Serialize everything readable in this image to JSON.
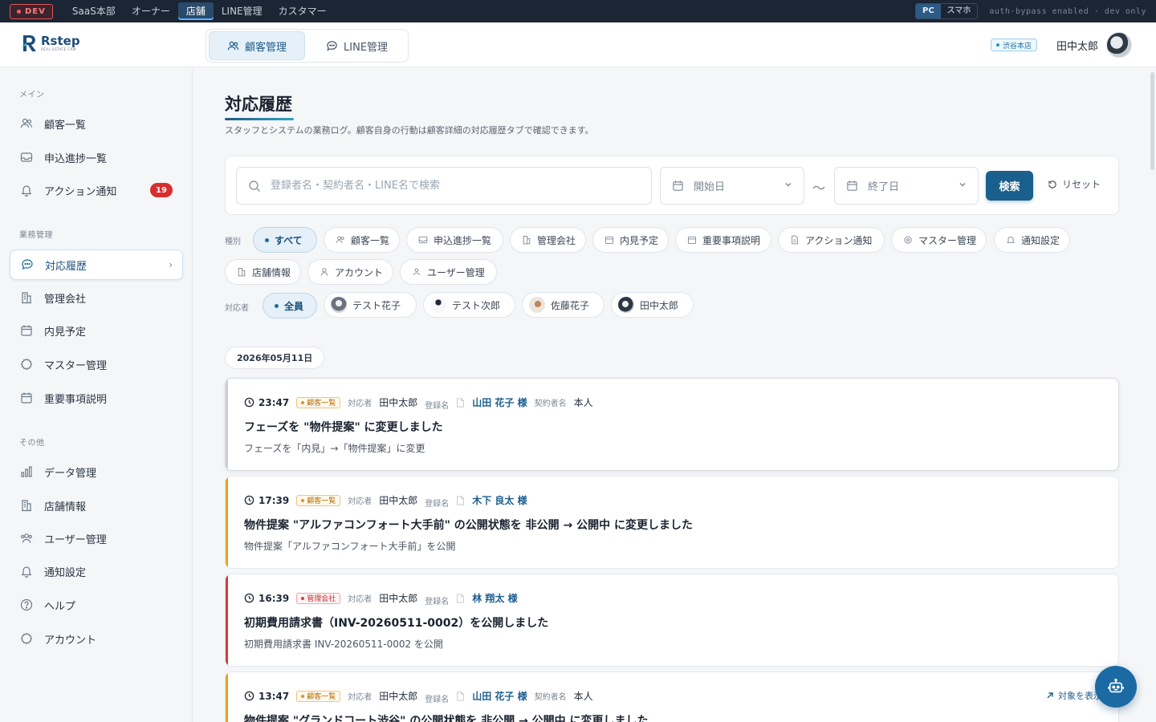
{
  "devbar": {
    "badge": "DEV",
    "tabs": [
      "SaaS本部",
      "オーナー",
      "店舗",
      "LINE管理",
      "カスタマー"
    ],
    "active_tab": "店舗",
    "device": [
      "PC",
      "スマホ"
    ],
    "note": "auth-bypass enabled · dev only"
  },
  "header": {
    "logo": "Rstep",
    "logo_sub": "REAL ESTATE CRM",
    "tabs": [
      "顧客管理",
      "LINE管理"
    ],
    "store": "渋谷本店",
    "user": "田中太郎"
  },
  "sidebar": {
    "sections": [
      "メイン",
      "業務管理",
      "その他"
    ],
    "main": [
      {
        "label": "顧客一覧",
        "icon": "users-icon"
      },
      {
        "label": "申込進捗一覧",
        "icon": "inbox-icon"
      },
      {
        "label": "アクション通知",
        "icon": "bell-icon",
        "count": "19"
      }
    ],
    "work": [
      {
        "label": "対応履歴",
        "icon": "chat-icon"
      },
      {
        "label": "管理会社",
        "icon": "building-icon"
      },
      {
        "label": "内見予定",
        "icon": "calendar-icon"
      },
      {
        "label": "マスター管理",
        "icon": "gear-icon"
      },
      {
        "label": "重要事項説明",
        "icon": "calendar-icon"
      }
    ],
    "other": [
      {
        "label": "データ管理",
        "icon": "chart-icon"
      },
      {
        "label": "店舗情報",
        "icon": "building-icon"
      },
      {
        "label": "ユーザー管理",
        "icon": "users-icon"
      },
      {
        "label": "通知設定",
        "icon": "bell-icon"
      },
      {
        "label": "ヘルプ",
        "icon": "help-icon"
      },
      {
        "label": "アカウント",
        "icon": "gear-icon"
      }
    ]
  },
  "page": {
    "title": "対応履歴",
    "description": "スタッフとシステムの業務ログ。顧客自身の行動は顧客詳細の対応履歴タブで確認できます。"
  },
  "search": {
    "placeholder": "登録者名・契約者名・LINE名で検索",
    "start_date": "開始日",
    "tilde": "〜",
    "end_date": "終了日",
    "search_label": "検索",
    "reset_label": "リセット"
  },
  "filters": {
    "type_label": "種別",
    "types": [
      "すべて",
      "顧客一覧",
      "申込進捗一覧",
      "管理会社",
      "内見予定",
      "重要事項説明",
      "アクション通知",
      "マスター管理",
      "通知設定",
      "店舗情報",
      "アカウント",
      "ユーザー管理"
    ],
    "staff_label": "対応者",
    "staff": [
      "全員",
      "テスト花子",
      "テスト次郎",
      "佐藤花子",
      "田中太郎"
    ]
  },
  "date_group": "2026年05月11日",
  "labels": {
    "staff": "対応者",
    "registrant": "登録名",
    "contractor": "契約者名",
    "jump": "対象を表示"
  },
  "entries": [
    {
      "time": "23:47",
      "tag": "顧客一覧",
      "staff": "田中太郎",
      "customer": "山田 花子 様",
      "contractor": "本人",
      "headline": "フェーズを \"物件提案\" に変更しました",
      "detail": "フェーズを「内見」→「物件提案」に変更"
    },
    {
      "time": "17:39",
      "tag": "顧客一覧",
      "staff": "田中太郎",
      "customer": "木下 良太 様",
      "headline": "物件提案 \"アルファコンフォート大手前\" の公開状態を 非公開 → 公開中 に変更しました",
      "detail": "物件提案「アルファコンフォート大手前」を公開"
    },
    {
      "time": "16:39",
      "tag": "管理会社",
      "staff": "田中太郎",
      "customer": "林 翔太 様",
      "headline": "初期費用請求書（INV-20260511-0002）を公開しました",
      "detail": "初期費用請求書 INV-20260511-0002 を公開"
    },
    {
      "time": "13:47",
      "tag": "顧客一覧",
      "staff": "田中太郎",
      "customer": "山田 花子 様",
      "contractor": "本人",
      "headline": "物件提案 \"グランドコート渋谷\" の公開状態を 非公開 → 公開中 に変更しました",
      "detail": ""
    }
  ],
  "colors": {
    "accent": "#1b5f8d",
    "orange": "#e8a317",
    "red": "#d63a3a",
    "gray": "#c8cfd7"
  }
}
